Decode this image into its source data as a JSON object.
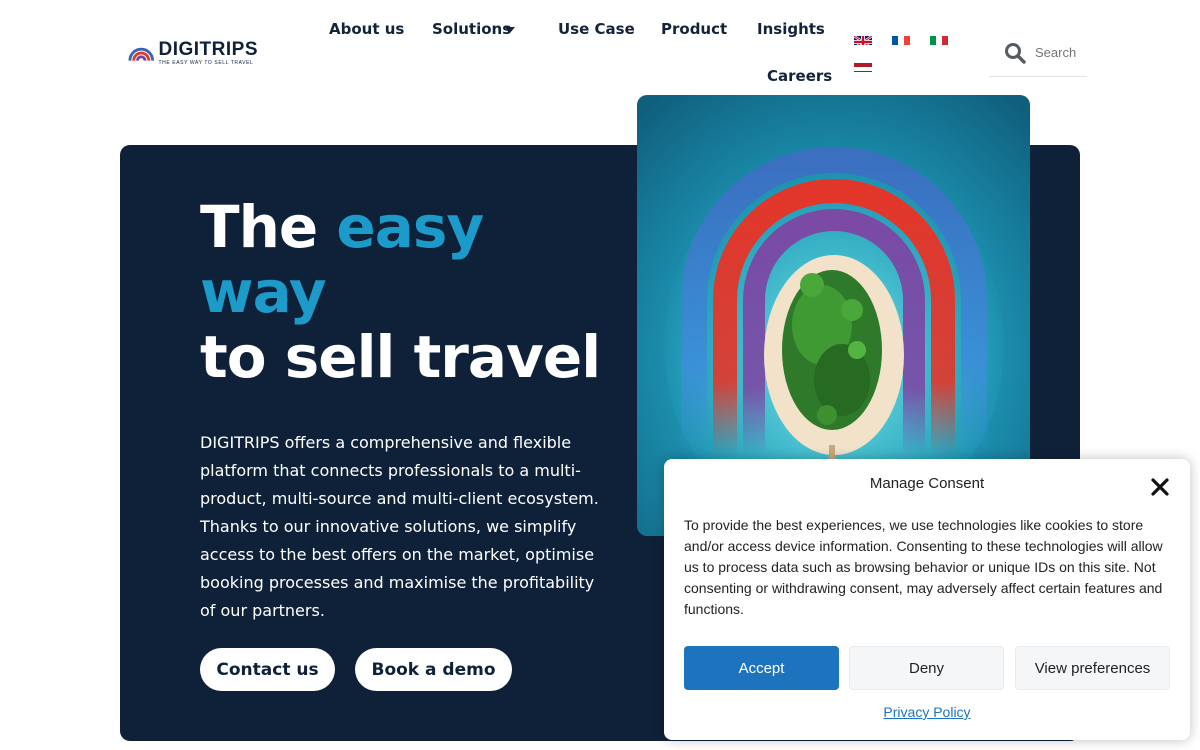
{
  "header": {
    "logo": {
      "name": "DIGITRIPS",
      "tagline": "THE EASY WAY TO SELL TRAVEL"
    },
    "nav": {
      "about": "About us",
      "solutions": "Solutions",
      "use_case": "Use Case",
      "product": "Product",
      "insights": "Insights",
      "careers": "Careers"
    },
    "languages": [
      "English",
      "French",
      "Italian",
      "Dutch"
    ],
    "search": {
      "placeholder": "Search"
    }
  },
  "hero": {
    "headline": {
      "part1": "The ",
      "accent1": "easy",
      "accent2": "way",
      "part2": "to sell travel"
    },
    "description": "DIGITRIPS offers a comprehensive and flexible platform that connects professionals to a multi-product, multi-source and multi-client ecosystem. Thanks to our innovative solutions, we simplify access to the best offers on the market, optimise booking processes and maximise the profitability of our partners.",
    "contact_label": "Contact us",
    "demo_label": "Book a demo",
    "image_icon": "tropical-island-aerial-photo"
  },
  "consent": {
    "title": "Manage Consent",
    "text": "To provide the best experiences, we use technologies like cookies to store and/or access device information. Consenting to these technologies will allow us to process data such as browsing behavior or unique IDs on this site. Not consenting or withdrawing consent, may adversely affect certain features and functions.",
    "accept_label": "Accept",
    "deny_label": "Deny",
    "preferences_label": "View preferences",
    "privacy_label": "Privacy Policy"
  },
  "colors": {
    "navy": "#0f2139",
    "accent": "#1c9ac9",
    "accept_blue": "#1e73be"
  }
}
